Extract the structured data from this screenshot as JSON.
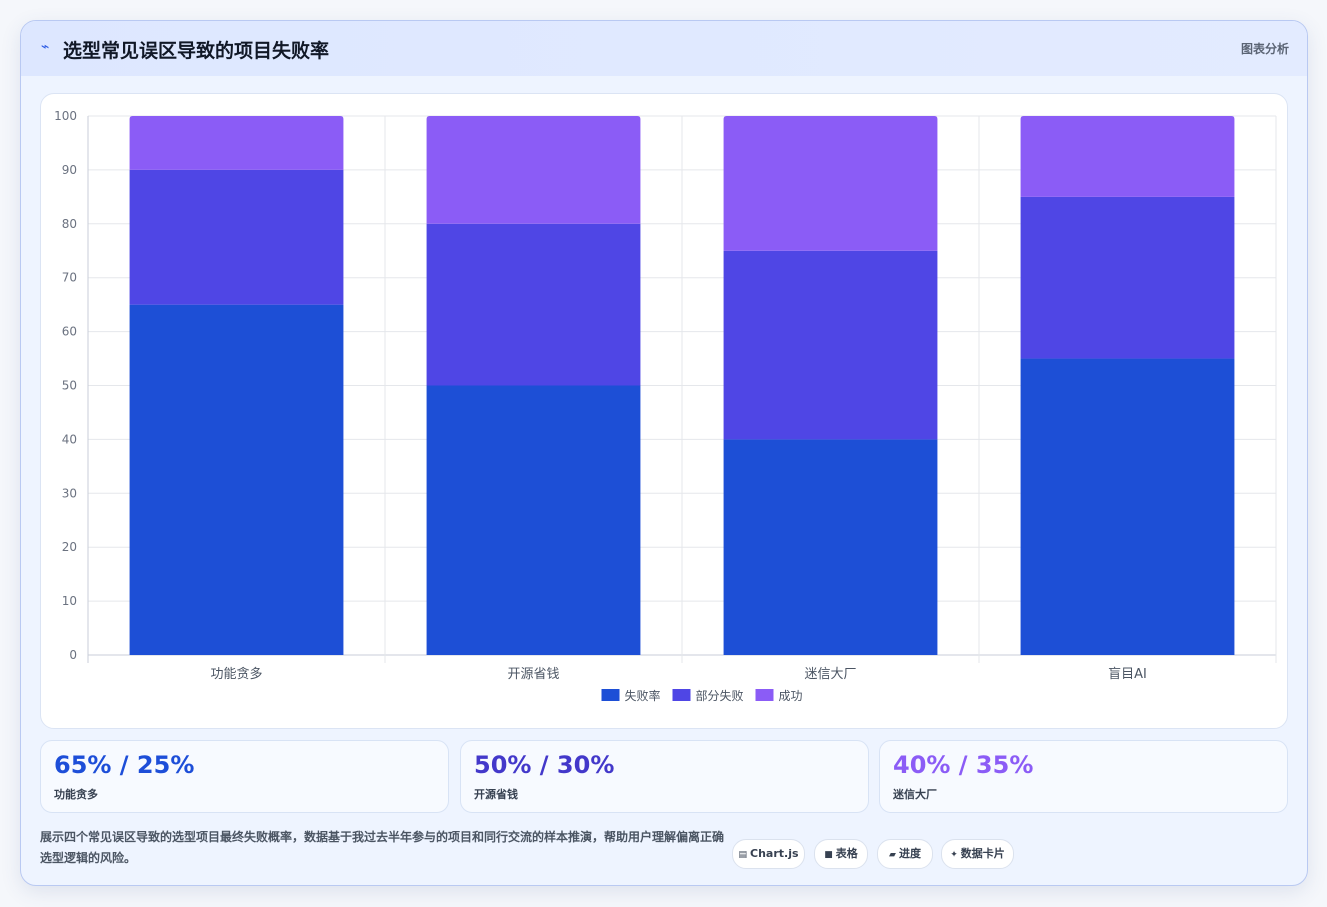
{
  "header": {
    "icon": "lightning-icon",
    "title": "选型常见误区导致的项目失败率",
    "tag": "图表分析"
  },
  "chart_data": {
    "type": "bar",
    "stacked": true,
    "categories": [
      "功能贪多",
      "开源省钱",
      "迷信大厂",
      "盲目AI"
    ],
    "series": [
      {
        "name": "失败率",
        "values": [
          65,
          50,
          40,
          55
        ],
        "color": "#1d4fd6"
      },
      {
        "name": "部分失败",
        "values": [
          25,
          30,
          35,
          30
        ],
        "color": "#4f46e5"
      },
      {
        "name": "成功",
        "values": [
          10,
          20,
          25,
          15
        ],
        "color": "#8b5cf6"
      }
    ],
    "ylim": [
      0,
      100
    ],
    "yticks": [
      0,
      10,
      20,
      30,
      40,
      50,
      60,
      70,
      80,
      90,
      100
    ],
    "grid": true,
    "legend": "bottom"
  },
  "stats": [
    {
      "value": "65% / 25%",
      "label": "功能贪多",
      "color": "#1d4ed8"
    },
    {
      "value": "50% / 30%",
      "label": "开源省钱",
      "color": "#4338ca"
    },
    {
      "value": "40% / 35%",
      "label": "迷信大厂",
      "color": "#8b5cf6"
    }
  ],
  "description": "展示四个常见误区导致的选型项目最终失败概率，数据基于我过去半年参与的项目和同行交流的样本推演，帮助用户理解偏离正确选型逻辑的风险。",
  "chips": [
    {
      "icon": "chart-icon",
      "glyph": "▤",
      "label": "Chart.js"
    },
    {
      "icon": "table-icon",
      "glyph": "■",
      "label": "表格"
    },
    {
      "icon": "progress-icon",
      "glyph": "▰",
      "label": "进度"
    },
    {
      "icon": "sparkle-icon",
      "glyph": "✦",
      "label": "数据卡片"
    }
  ]
}
